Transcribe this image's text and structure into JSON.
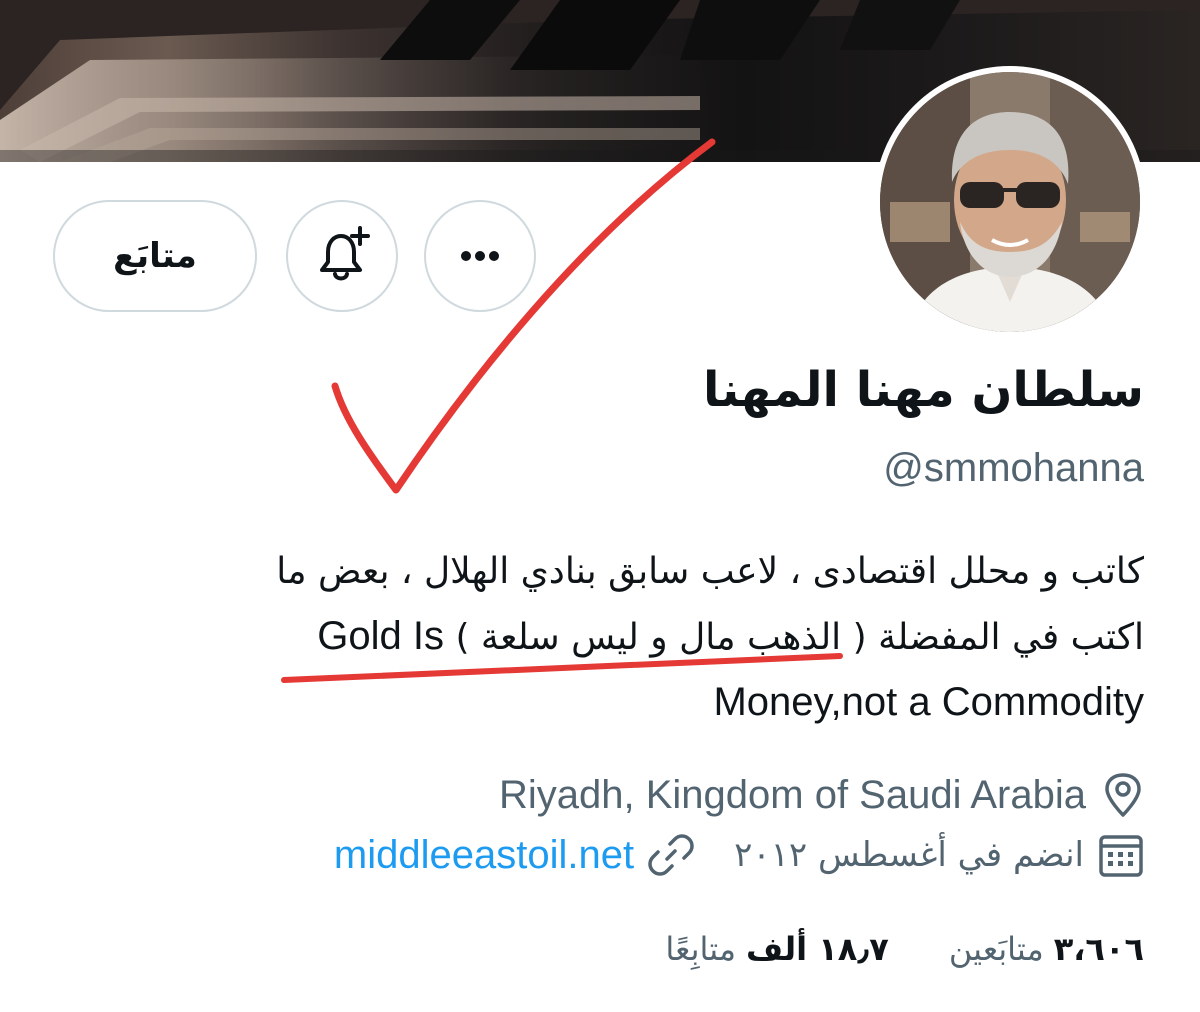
{
  "profile": {
    "name": "سلطان مهنا المهنا",
    "handle": "@smmohanna",
    "bio": {
      "line1": "كاتب و محلل اقتصادى ، لاعب سابق بنادي الهلال ، بعض ما",
      "line2_ar": "اكتب في المفضلة ( الذهب مال و ليس سلعة )",
      "line2_en": "Gold Is",
      "line3": "Money,not a Commodity"
    },
    "location": "Riyadh, Kingdom of Saudi Arabia",
    "joined": "انضم في أغسطس ٢٠١٢",
    "website": "middleeastoil.net"
  },
  "actions": {
    "follow_label": "متابَع",
    "bell_icon": "notification-bell-plus-icon",
    "more_icon": "more-dots-icon"
  },
  "stats": {
    "following_count": "٣،٦٠٦",
    "following_label": "متابَعين",
    "followers_count": "١٨٫٧",
    "followers_unit": "ألف",
    "followers_label": "متابِعًا"
  },
  "colors": {
    "accent": "#1d9bf0",
    "secondary_text": "#536471",
    "annotation": "#e53935"
  }
}
